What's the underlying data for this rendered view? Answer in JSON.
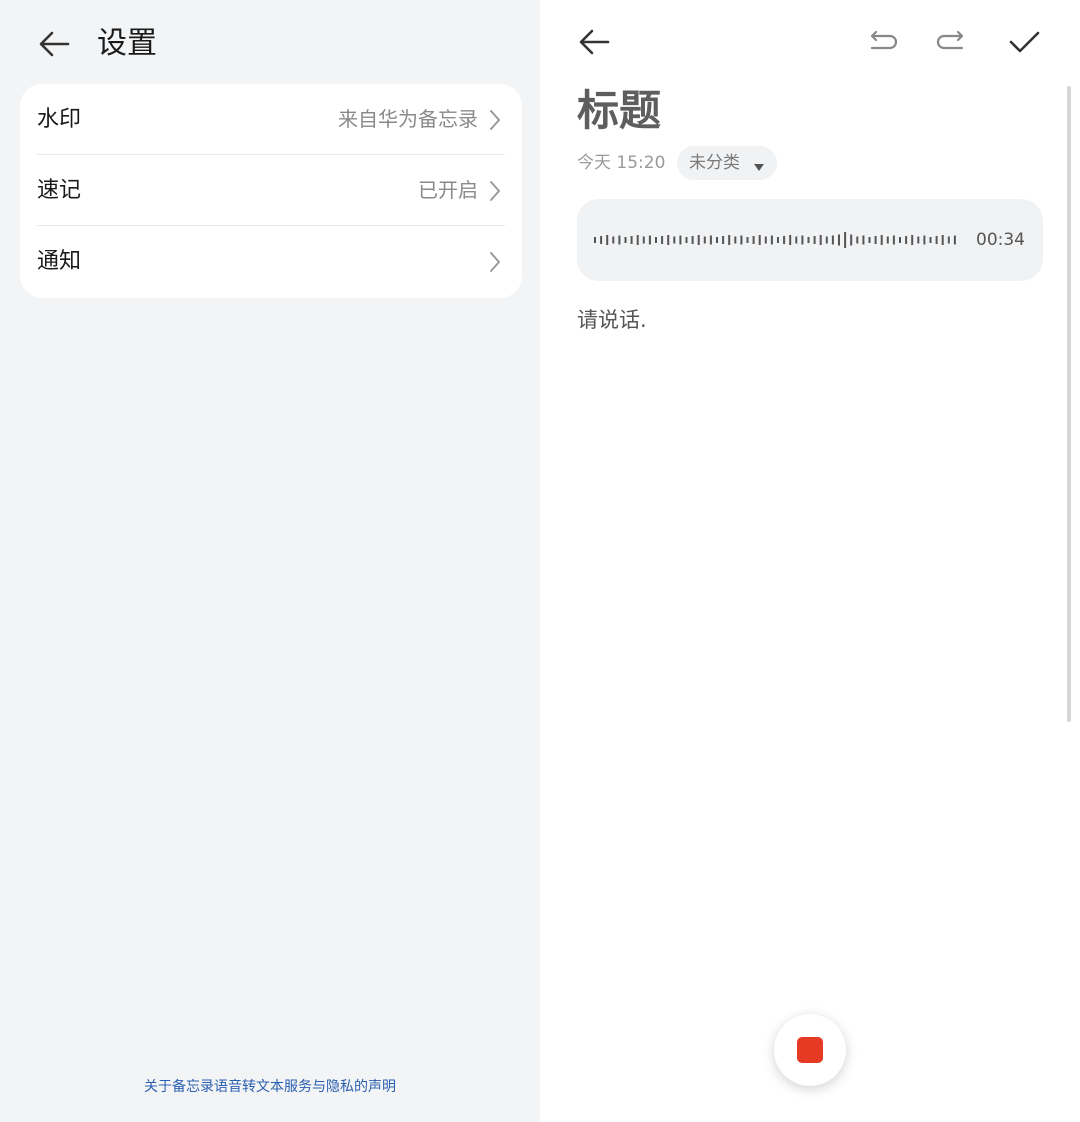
{
  "colors": {
    "left_bg": "#f2f4f6",
    "card_bg": "#ffffff",
    "link": "#2b5fb0",
    "record_stop": "#e63a24",
    "icon_stroke": "#333333"
  },
  "left_panel": {
    "back_icon": "arrow-left-icon",
    "title": "设置",
    "settings_rows": [
      {
        "label": "水印",
        "value": "来自华为备忘录",
        "icon": "chevron-right-icon"
      },
      {
        "label": "速记",
        "value": "已开启",
        "icon": "chevron-right-icon"
      },
      {
        "label": "通知",
        "value": "",
        "icon": "chevron-right-icon"
      }
    ],
    "footer_link": "关于备忘录语音转文本服务与隐私的声明"
  },
  "right_panel": {
    "toolbar": {
      "back_icon": "arrow-left-icon",
      "undo_icon": "undo-icon",
      "redo_icon": "redo-icon",
      "confirm_icon": "checkmark-icon"
    },
    "note": {
      "title": "标题",
      "time": "今天 15:20",
      "category": "未分类",
      "category_icon": "caret-down-icon"
    },
    "audio": {
      "icon": "waveform-icon",
      "duration": "00:34"
    },
    "body_text": "请说话.",
    "record_button_icon": "stop-icon"
  }
}
